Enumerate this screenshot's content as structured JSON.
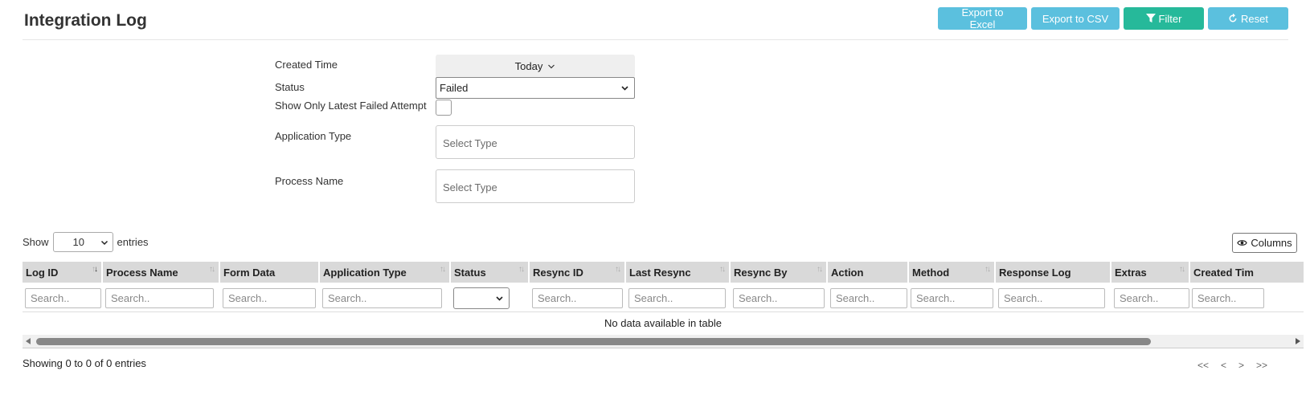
{
  "page": {
    "title": "Integration Log"
  },
  "toolbar": {
    "export_excel": "Export to Excel",
    "export_csv": "Export to CSV",
    "filter": "Filter",
    "reset": "Reset",
    "info_color": "#5bc0de",
    "success_color": "#26b99a"
  },
  "filters": {
    "created_time": {
      "label": "Created Time",
      "value": "Today"
    },
    "status": {
      "label": "Status",
      "value": "Failed"
    },
    "latest_failed": {
      "label": "Show Only Latest Failed Attempt",
      "checked": false
    },
    "application_type": {
      "label": "Application Type",
      "placeholder": "Select Type"
    },
    "process_name": {
      "label": "Process Name",
      "placeholder": "Select Type"
    }
  },
  "table_controls": {
    "show_label": "Show",
    "entries_label": "entries",
    "page_length": "10",
    "columns_button": "Columns"
  },
  "table": {
    "columns": [
      "Log ID",
      "Process Name",
      "Form Data",
      "Application Type",
      "Status",
      "Resync ID",
      "Last Resync",
      "Resync By",
      "Action",
      "Method",
      "Response Log",
      "Extras",
      "Created Tim"
    ],
    "search_placeholder": "Search..",
    "empty_message": "No data available in table",
    "info": "Showing 0 to 0 of 0 entries"
  },
  "pagination": {
    "first": "<<",
    "prev": "<",
    "next": ">",
    "last": ">>"
  }
}
